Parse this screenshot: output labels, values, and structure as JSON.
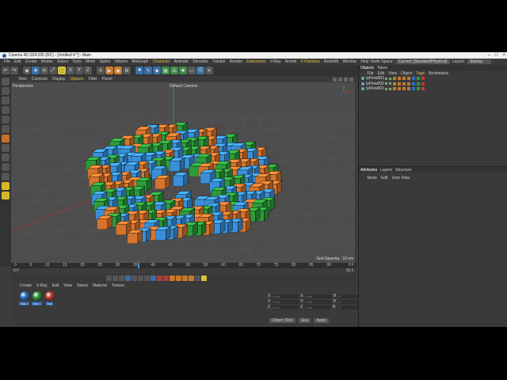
{
  "title": "Cinema 4D S24.035 (RC) - [Untitled 4 *] - Main",
  "window_controls": [
    "–",
    "□",
    "×"
  ],
  "menu": [
    "File",
    "Edit",
    "Create",
    "Modes",
    "Select",
    "Tools",
    "Mesh",
    "Spline",
    "Volume",
    "MoGraph",
    "Character",
    "Animate",
    "Simulate",
    "Tracker",
    "Render",
    "Extensions",
    "V-Ray",
    "Arnold",
    "X-Particles",
    "Redshift",
    "Window",
    "Help"
  ],
  "menu_highlight": [
    "Character",
    "Extensions",
    "X-Particles"
  ],
  "node_space_label": "Node Space:",
  "node_space_value": "Current (Standard/Physical)",
  "layout_label": "Layout:",
  "layout_value": "Startup",
  "viewport_menu": [
    "View",
    "Cameras",
    "Display",
    "Options",
    "Filter",
    "Panel"
  ],
  "viewport_menu_active": "Options",
  "viewport_label": "Perspective",
  "camera_label": "Default Camera",
  "grid_spacing": "Grid Spacing : 10 cm",
  "timeline_ticks": [
    "0",
    "5",
    "10",
    "15",
    "20",
    "25",
    "30",
    "35",
    "40",
    "45",
    "50",
    "55",
    "60",
    "65",
    "70",
    "75",
    "80",
    "85",
    "90"
  ],
  "timeline_current": "0 F",
  "timeline_start": "0 F",
  "timeline_end": "90 F",
  "timeline_max": "90 F",
  "material_menu": [
    "Create",
    "V-Ray",
    "Edit",
    "View",
    "Select",
    "Material",
    "Texture"
  ],
  "materials": [
    {
      "label": "Mat.2",
      "color": "#2a6fc4"
    },
    {
      "label": "Mat.1",
      "color": "#2e9a3c"
    },
    {
      "label": "Mat",
      "color": "#c43a2a"
    }
  ],
  "coords": {
    "rows": [
      {
        "a": "X",
        "av": "0 cm",
        "b": "X",
        "bv": "0 cm",
        "c": "H",
        "cv": "0 °"
      },
      {
        "a": "Y",
        "av": "0 cm",
        "b": "Y",
        "bv": "0 cm",
        "c": "P",
        "cv": "0 °"
      },
      {
        "a": "Z",
        "av": "0 cm",
        "b": "Z",
        "bv": "0 cm",
        "c": "B",
        "cv": "0 °"
      }
    ],
    "mode_dropdown": "Object (Rel)",
    "size_dropdown": "Size",
    "apply_button": "Apply"
  },
  "object_tabs": [
    "Objects",
    "Takes"
  ],
  "object_menu": [
    "File",
    "Edit",
    "View",
    "Object",
    "Tags",
    "Bookmarks"
  ],
  "object_menu_active": "Tags",
  "objects": [
    {
      "name": "tyFlow003"
    },
    {
      "name": "tyFlow002"
    },
    {
      "name": "tyFlow001"
    }
  ],
  "attr_tabs": [
    "Attributes",
    "Layers",
    "Structure"
  ],
  "attr_menu": [
    "Mode",
    "Edit",
    "User Data"
  ],
  "colors": {
    "blue": "#3a8fd8",
    "green": "#2e9a3c",
    "orange": "#d4742e"
  }
}
